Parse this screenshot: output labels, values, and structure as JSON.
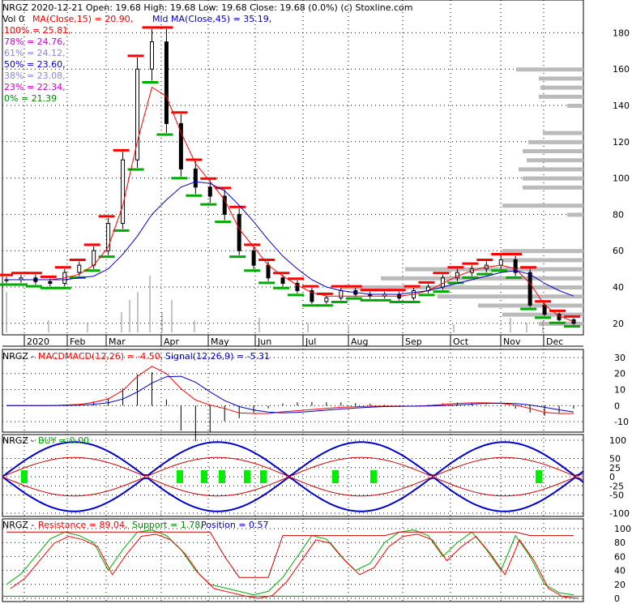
{
  "header": {
    "line1": "NRGZ  2020-12-21 Open: 19.68  High: 19.68  Low: 19.68  Close: 19.68 (0.0%)  (c) Stoxline.com",
    "vol": "Vol 0",
    "ma": "MA(Close,15) = 20.90,",
    "midma": "Mid MA(Close,45) = 35.19,"
  },
  "fib": [
    {
      "label": "100% = 25.81,",
      "color": "#ff0000"
    },
    {
      "label": "78% = 24.76,",
      "color": "#cc00cc"
    },
    {
      "label": "61% = 24.12,",
      "color": "#8888cc"
    },
    {
      "label": "50% = 23.60,",
      "color": "#0000cc"
    },
    {
      "label": "38% = 23.08,",
      "color": "#8888cc"
    },
    {
      "label": "23% = 22.34,",
      "color": "#cc00cc"
    },
    {
      "label": "0% = 21.39",
      "color": "#008800"
    }
  ],
  "months": [
    "2020",
    "Feb",
    "Mar",
    "Apr",
    "May",
    "Jun",
    "Jul",
    "Aug",
    "Sep",
    "Oct",
    "Nov",
    "Dec"
  ],
  "price_ticks": [
    "180",
    "160",
    "140",
    "120",
    "100",
    "80",
    "60",
    "40",
    "20"
  ],
  "macd": {
    "name": "NRGZ - ",
    "macd_label": "MACDMACD(12,26) = -4.50,",
    "signal_label": "Signal(12,26,9) = -5.31",
    "ticks": [
      "30",
      "20",
      "10",
      "0",
      "-10"
    ]
  },
  "buy": {
    "name": "NRGZ - ",
    "label": "BUY = 0.00",
    "ticks": [
      "100",
      "50",
      "25",
      "0",
      "-25",
      "-50",
      "-100"
    ]
  },
  "stoch": {
    "name": "NRGZ - ",
    "resistance": "Resistance = 89.04,",
    "support": "Support = 1.78,",
    "position": "Position = 0.57",
    "ticks": [
      "100",
      "80",
      "60",
      "40",
      "20",
      "0"
    ]
  },
  "colors": {
    "up": "#000000",
    "down": "#000000",
    "ma": "#ff0000",
    "midma": "#0000cc",
    "signal": "#0000cc",
    "buy_marker": "#00ee00",
    "support": "#008800",
    "resistance": "#ff0000",
    "profile": "#bbbbbb"
  },
  "chart_data": {
    "type": "line",
    "title": "NRGZ  2020-12-21",
    "ylim": [
      15,
      190
    ],
    "x": [
      "2020-01",
      "2020-01",
      "2020-01",
      "2020-02",
      "2020-02",
      "2020-02",
      "2020-03",
      "2020-03",
      "2020-03",
      "2020-03",
      "2020-03",
      "2020-03",
      "2020-04",
      "2020-04",
      "2020-04",
      "2020-04",
      "2020-05",
      "2020-05",
      "2020-05",
      "2020-06",
      "2020-06",
      "2020-06",
      "2020-07",
      "2020-07",
      "2020-07",
      "2020-08",
      "2020-08",
      "2020-08",
      "2020-09",
      "2020-09",
      "2020-09",
      "2020-10",
      "2020-10",
      "2020-10",
      "2020-11",
      "2020-11",
      "2020-11",
      "2020-12",
      "2020-12",
      "2020-12"
    ],
    "series": [
      {
        "name": "Close",
        "values": [
          44,
          45,
          43,
          42,
          48,
          52,
          60,
          75,
          110,
          160,
          175,
          130,
          105,
          95,
          90,
          80,
          60,
          52,
          45,
          42,
          38,
          32,
          34,
          38,
          36,
          35,
          36,
          34,
          38,
          40,
          45,
          48,
          50,
          52,
          55,
          48,
          30,
          25,
          22,
          20
        ]
      },
      {
        "name": "MA(Close,15)",
        "values": [
          44,
          44,
          44,
          44,
          45,
          47,
          52,
          62,
          85,
          120,
          150,
          145,
          125,
          108,
          98,
          88,
          72,
          62,
          52,
          46,
          41,
          37,
          35,
          35,
          35,
          35,
          35,
          35,
          36,
          38,
          42,
          46,
          49,
          51,
          52,
          50,
          42,
          30,
          24,
          21
        ]
      },
      {
        "name": "Mid MA(Close,45)",
        "values": [
          44,
          44,
          44,
          44,
          44,
          45,
          46,
          50,
          58,
          68,
          80,
          88,
          95,
          98,
          97,
          93,
          85,
          76,
          66,
          57,
          50,
          44,
          40,
          38,
          37,
          36,
          36,
          36,
          37,
          38,
          40,
          42,
          44,
          46,
          48,
          49,
          47,
          42,
          38,
          35
        ]
      }
    ]
  }
}
